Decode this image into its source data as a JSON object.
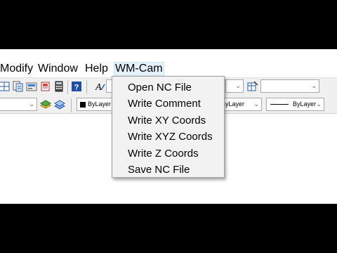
{
  "menubar": {
    "items": [
      "Modify",
      "Window",
      "Help",
      "WM-Cam"
    ]
  },
  "toolbar1": {
    "icons": [
      "design-center-icon",
      "tool-palettes-icon",
      "properties-icon",
      "sheet-set-icon",
      "markup-icon",
      "calculator-icon",
      "help-icon",
      "text-style-icon"
    ],
    "combos": [
      "",
      ""
    ]
  },
  "toolbar2": {
    "combos": [
      "ByLayer",
      "ByLayer",
      "ByLayer"
    ],
    "icons": [
      "layer-states-icon",
      "layer-previous-icon"
    ]
  },
  "dropdown": {
    "items": [
      "Open NC File",
      "Write Comment",
      "Write XY Coords",
      "Write XYZ Coords",
      "Write Z Coords",
      "Save NC File"
    ]
  },
  "colors": {
    "letterbox": "#000000",
    "toolbar_bg": "#f0f0f0",
    "menu_bg": "#f2f2f2",
    "active_menu": "#e5f1fb"
  }
}
